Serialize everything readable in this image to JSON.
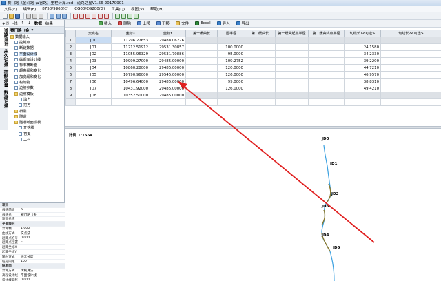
{
  "window": {
    "title": "赛门路（金斗路-云谷路）里程计算.rod - 道路之星V1.56-20170901"
  },
  "menu": [
    "文件(F)",
    "编辑(E)",
    "8750/9860(C)",
    "CG00/CG200(G)",
    "工具(Q)",
    "视图(V)",
    "帮助(H)"
  ],
  "left_toolbar": [
    "+线",
    "-线",
    "↑",
    "↓",
    "数据",
    "结果"
  ],
  "vtabs": [
    "道路设计",
    "永久记录",
    "控制测量",
    "数据记录"
  ],
  "tree": {
    "header": [
      "赛门路（金",
      "▾"
    ],
    "items": [
      {
        "label": "数据输入",
        "type": "folder",
        "indent": 0
      },
      {
        "label": "控制点",
        "type": "doc",
        "indent": 1
      },
      {
        "label": "断链数据",
        "type": "doc",
        "indent": 1
      },
      {
        "label": "平面设计线",
        "type": "doc",
        "indent": 1
      },
      {
        "label": "纵断面设计线",
        "type": "doc",
        "indent": 1
      },
      {
        "label": "标准横断面",
        "type": "doc",
        "indent": 1
      },
      {
        "label": "超高缓和变化",
        "type": "doc",
        "indent": 1
      },
      {
        "label": "加宽缓和变化",
        "type": "doc",
        "indent": 1
      },
      {
        "label": "构筑物",
        "type": "doc",
        "indent": 1
      },
      {
        "label": "边坡参数",
        "type": "doc",
        "indent": 1
      },
      {
        "label": "边坡模板",
        "type": "folder",
        "indent": 1
      },
      {
        "label": "填方",
        "type": "doc",
        "indent": 2
      },
      {
        "label": "挖方",
        "type": "doc",
        "indent": 2
      },
      {
        "label": "桥梁",
        "type": "folder",
        "indent": 1
      },
      {
        "label": "隧道",
        "type": "folder",
        "indent": 1
      },
      {
        "label": "隧道断面模板",
        "type": "folder",
        "indent": 1
      },
      {
        "label": "开挖线",
        "type": "doc",
        "indent": 2
      },
      {
        "label": "初支",
        "type": "doc",
        "indent": 2
      },
      {
        "label": "二衬",
        "type": "doc",
        "indent": 2
      }
    ]
  },
  "props": [
    {
      "k": "项目",
      "v": "",
      "group": true
    },
    {
      "k": "线路前缀",
      "v": "K"
    },
    {
      "k": "线路名",
      "v": "赛门路（金"
    },
    {
      "k": "项目名称",
      "v": ""
    },
    {
      "k": "平面线形",
      "v": "",
      "group": true
    },
    {
      "k": "计算精",
      "v": "1.000"
    },
    {
      "k": "曲线方式",
      "v": "交点法"
    },
    {
      "k": "起算点桩号",
      "v": "0.000"
    },
    {
      "k": "起算点位置",
      "v": "E"
    },
    {
      "k": "起算坐标X",
      "v": ""
    },
    {
      "k": "起算坐标Y",
      "v": ""
    },
    {
      "k": "输入方式",
      "v": "线元长度"
    },
    {
      "k": "桩号间距",
      "v": "100"
    },
    {
      "k": "纵断面",
      "v": "",
      "group": true
    },
    {
      "k": "计算方式",
      "v": "传统算法"
    },
    {
      "k": "高程设计线",
      "v": "平面设计线"
    },
    {
      "k": "设计线偏移",
      "v": "0.000"
    },
    {
      "k": "图形纵横比",
      "v": "20"
    }
  ],
  "table_toolbar": {
    "insert": "插入",
    "delete": "删除",
    "up": "上移",
    "down": "下移",
    "file": "文件",
    "excel": "Excel",
    "import": "导入",
    "export": "导出"
  },
  "table": {
    "columns": [
      "交点名",
      "坐标X",
      "坐标Y",
      "第一缓曲长",
      "圆半径",
      "第二缓曲长",
      "第一缓曲起点半径",
      "第二缓曲终点半径",
      "切线长1<可选>",
      "切线长2<可选>"
    ],
    "rows": [
      {
        "n": "1",
        "name": "JD0",
        "x": "11296.27653",
        "y": "29488.06226",
        "l1": "",
        "r": "",
        "l2": "",
        "r1": "",
        "r2": "",
        "t1": "",
        "t2": ""
      },
      {
        "n": "2",
        "name": "JD1",
        "x": "11212.51912",
        "y": "29531.30857",
        "l1": "",
        "r": "100.0000",
        "l2": "",
        "r1": "",
        "r2": "",
        "t1": "24.1580",
        "t2": ""
      },
      {
        "n": "3",
        "name": "JD2",
        "x": "11055.96329",
        "y": "29531.70886",
        "l1": "",
        "r": "95.0000",
        "l2": "",
        "r1": "",
        "r2": "",
        "t1": "34.2330",
        "t2": ""
      },
      {
        "n": "4",
        "name": "JD3",
        "x": "10999.27000",
        "y": "29485.00000",
        "l1": "",
        "r": "109.2752",
        "l2": "",
        "r1": "",
        "r2": "",
        "t1": "39.2200",
        "t2": ""
      },
      {
        "n": "5",
        "name": "JD4",
        "x": "10860.28000",
        "y": "29485.00000",
        "l1": "",
        "r": "120.0000",
        "l2": "",
        "r1": "",
        "r2": "",
        "t1": "44.7210",
        "t2": ""
      },
      {
        "n": "6",
        "name": "JD5",
        "x": "10790.96000",
        "y": "29545.00000",
        "l1": "",
        "r": "126.0000",
        "l2": "",
        "r1": "",
        "r2": "",
        "t1": "46.9570",
        "t2": ""
      },
      {
        "n": "7",
        "name": "JD6",
        "x": "10496.64000",
        "y": "29485.00000",
        "l1": "",
        "r": "99.0000",
        "l2": "",
        "r1": "",
        "r2": "",
        "t1": "38.8310",
        "t2": ""
      },
      {
        "n": "8",
        "name": "JD7",
        "x": "10431.92000",
        "y": "29485.00000",
        "l1": "",
        "r": "126.0000",
        "l2": "",
        "r1": "",
        "r2": "",
        "t1": "49.4210",
        "t2": ""
      },
      {
        "n": "9",
        "name": "JD8",
        "x": "10352.50000",
        "y": "29485.00000",
        "l1": "",
        "r": "",
        "l2": "",
        "r1": "",
        "r2": "",
        "t1": "",
        "t2": ""
      }
    ]
  },
  "canvas": {
    "scale_label": "比例 1:1554",
    "jd_labels": [
      "JD0",
      "JD1",
      "JD2",
      "JD3",
      "JD4",
      "JD5"
    ]
  },
  "colors": {
    "arrow": "#e02020",
    "road_line": "#3aa0e0",
    "curve": "#8a7a30"
  }
}
